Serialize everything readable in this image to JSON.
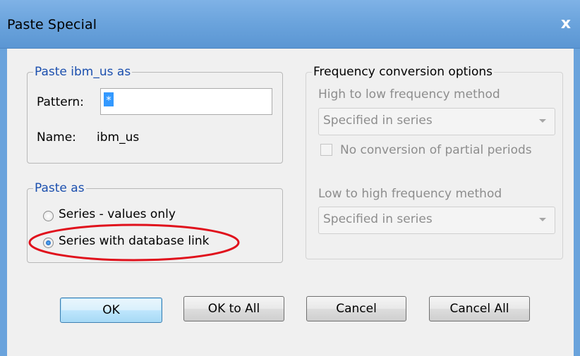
{
  "window": {
    "title": "Paste Special",
    "close_glyph": "x"
  },
  "paste_ibm_group": {
    "legend": "Paste ibm_us as",
    "pattern_label": "Pattern:",
    "pattern_value": "*",
    "name_label": "Name:",
    "name_value": "ibm_us"
  },
  "paste_as_group": {
    "legend": "Paste as",
    "options": [
      {
        "label": "Series - values only",
        "checked": false
      },
      {
        "label": "Series with database link",
        "checked": true
      }
    ],
    "highlight_color": "#e0111c"
  },
  "frequency_group": {
    "legend": "Frequency conversion options",
    "high_to_low_label": "High to low frequency method",
    "high_to_low_value": "Specified in series",
    "no_conversion_label": "No conversion of partial periods",
    "no_conversion_checked": false,
    "low_to_high_label": "Low to high frequency method",
    "low_to_high_value": "Specified in series"
  },
  "buttons": {
    "ok": "OK",
    "ok_all": "OK to All",
    "cancel": "Cancel",
    "cancel_all": "Cancel All"
  },
  "colors": {
    "title_bar": "#6aa3dc",
    "legend_blue": "#1b4fae",
    "selection": "#3399ff"
  }
}
